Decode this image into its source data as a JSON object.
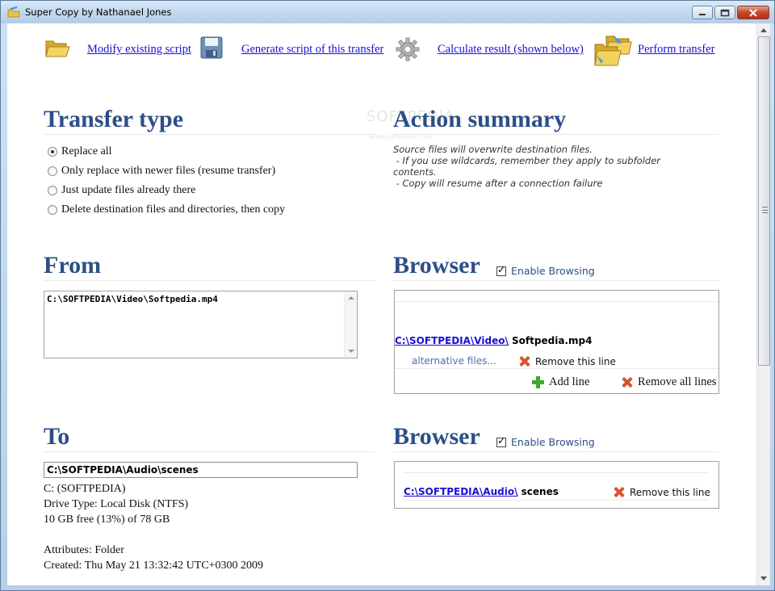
{
  "window": {
    "title": "Super Copy by Nathanael Jones"
  },
  "toolbar": {
    "modify_label": "Modify existing script",
    "generate_label": "Generate script of this transfer",
    "calculate_label": "Calculate result (shown below)",
    "perform_label": "Perform transfer"
  },
  "transfer_type": {
    "heading": "Transfer type",
    "options": [
      {
        "label": "Replace all",
        "checked": true
      },
      {
        "label": "Only replace with newer files (resume transfer)",
        "checked": false
      },
      {
        "label": "Just update files already there",
        "checked": false
      },
      {
        "label": "Delete destination files and directories, then copy",
        "checked": false
      }
    ]
  },
  "action_summary": {
    "heading": "Action summary",
    "text": "Source files will overwrite destination files.\n - If you use wildcards, remember they apply to subfolder\ncontents.\n - Copy will resume after a connection failure"
  },
  "from": {
    "heading": "From",
    "value": "C:\\SOFTPEDIA\\Video\\Softpedia.mp4"
  },
  "browser_from": {
    "heading": "Browser",
    "enable_label": "Enable Browsing",
    "enabled": true,
    "path_link": "C:\\SOFTPEDIA\\Video\\",
    "path_file": " Softpedia.mp4",
    "alternative_label": "alternative files...",
    "remove_line_label": "Remove this line",
    "add_line_label": "Add line",
    "remove_all_label": "Remove all lines"
  },
  "to": {
    "heading": "To",
    "value": "C:\\SOFTPEDIA\\Audio\\scenes",
    "drive": "C: (SOFTPEDIA)",
    "drive_type": "Drive Type: Local Disk (NTFS)",
    "free": "10 GB free (13%) of 78 GB",
    "attributes": "Attributes: Folder",
    "created": "Created: Thu May 21 13:32:42 UTC+0300 2009"
  },
  "browser_to": {
    "heading": "Browser",
    "enable_label": "Enable Browsing",
    "enabled": true,
    "path_link": "C:\\SOFTPEDIA\\Audio\\",
    "path_file": " scenes",
    "remove_line_label": "Remove this line"
  },
  "watermark": {
    "text": "SOFTPEDIA",
    "sub": "www.softpedia.com"
  },
  "icons": [
    "folder-open-icon",
    "floppy-save-icon",
    "gear-icon",
    "folders-transfer-icon",
    "remove-x-icon",
    "add-plus-icon"
  ]
}
